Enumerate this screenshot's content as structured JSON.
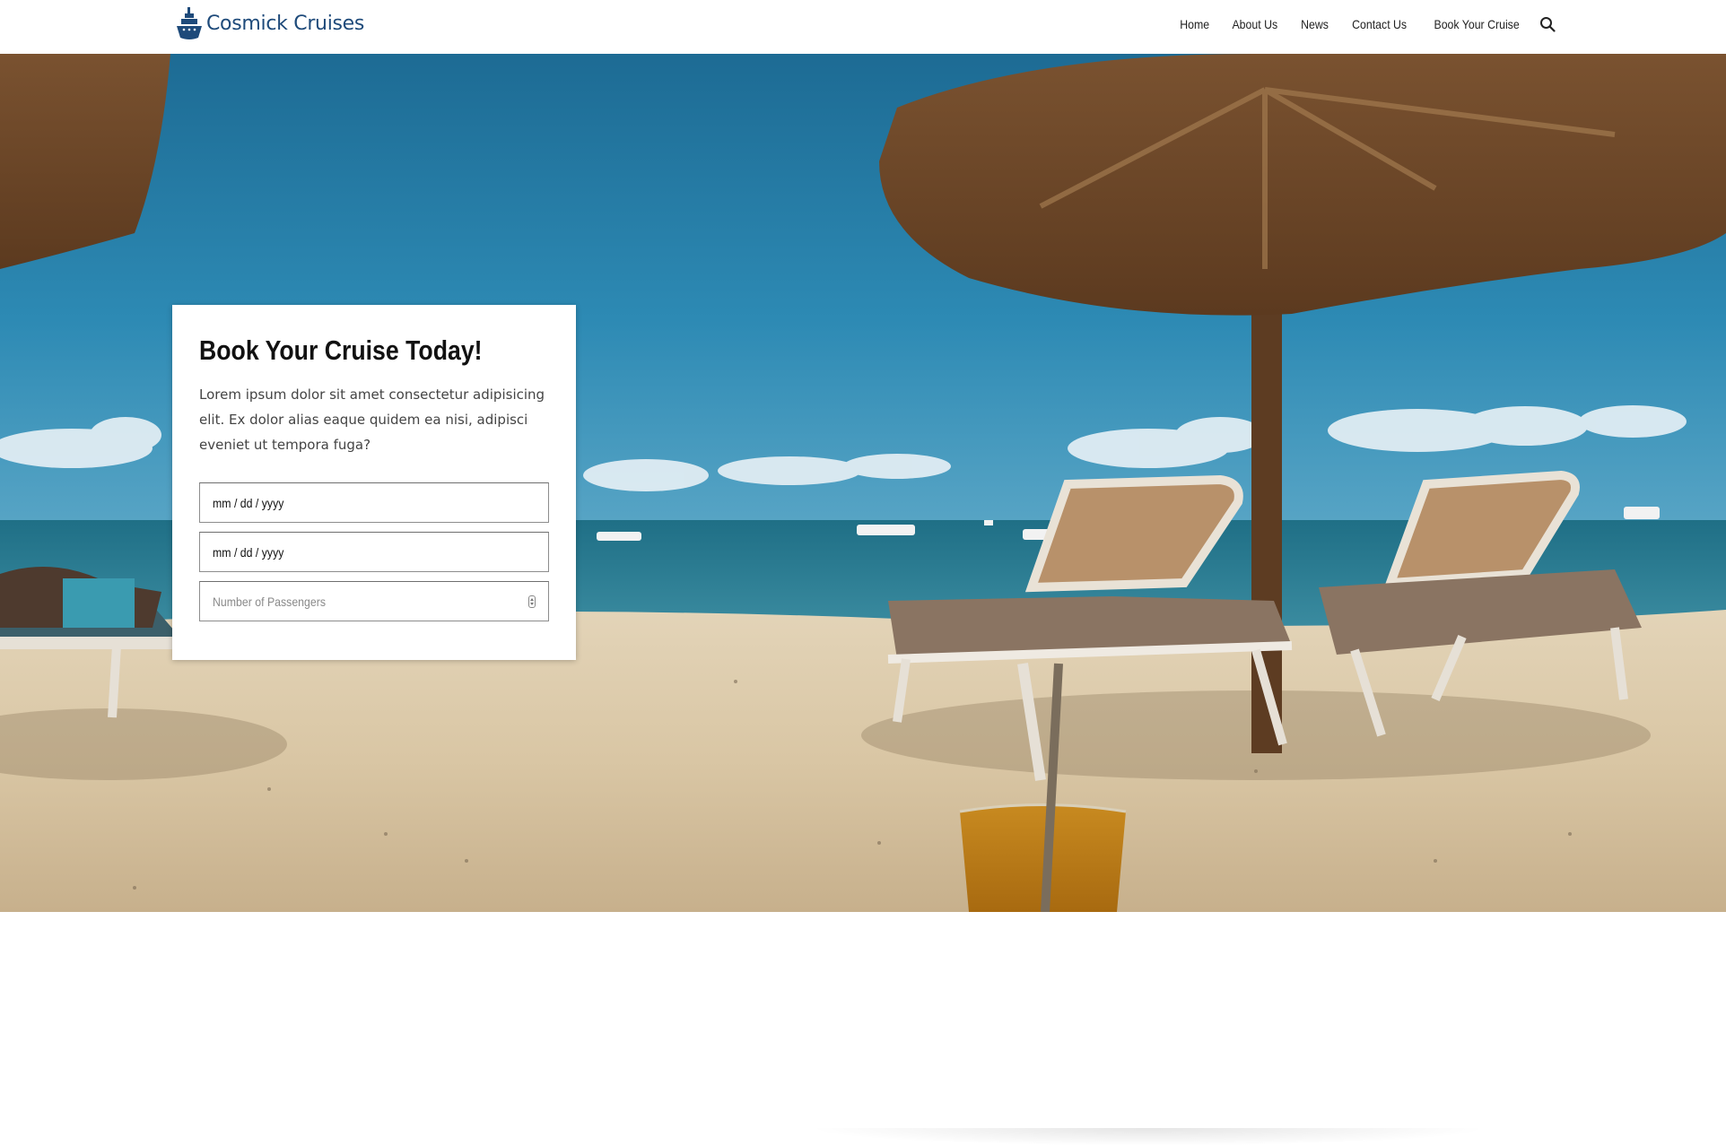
{
  "brand": {
    "name": "Cosmick Cruises",
    "icon": "ship-icon",
    "color": "#1e4a7a"
  },
  "nav": {
    "items": [
      {
        "label": "Home"
      },
      {
        "label": "About Us"
      },
      {
        "label": "News"
      },
      {
        "label": "Contact Us"
      },
      {
        "label": "Book Your Cruise"
      }
    ],
    "search_icon": "search-icon"
  },
  "hero": {
    "image": "beach-with-thatched-umbrellas-and-lounge-chairs"
  },
  "booking": {
    "title": "Book Your Cruise Today!",
    "description": "Lorem ipsum dolor sit amet consectetur adipisicing elit. Ex dolor alias eaque quidem ea nisi, adipisci eveniet ut tempora fuga?",
    "start_date": {
      "value": "mm / dd / yyyy"
    },
    "end_date": {
      "value": "mm / dd / yyyy"
    },
    "passengers": {
      "placeholder": "Number of Passengers"
    }
  }
}
